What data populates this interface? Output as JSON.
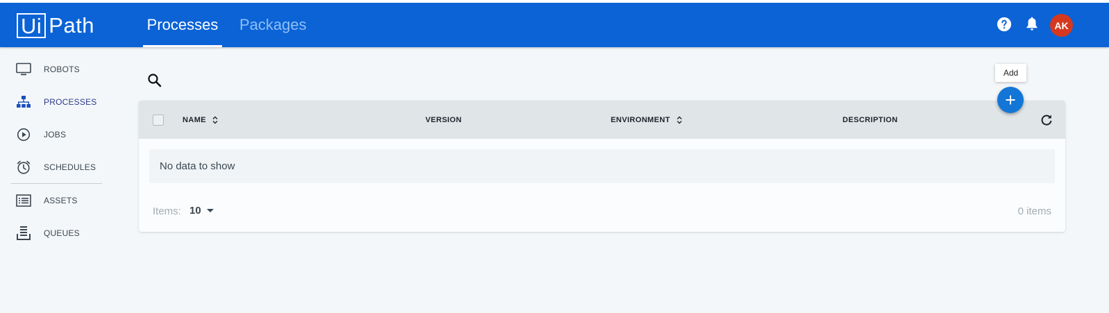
{
  "header": {
    "logo_text_boxed": "Ui",
    "logo_text_rest": "Path",
    "tabs": [
      {
        "label": "Processes",
        "active": true
      },
      {
        "label": "Packages",
        "active": false
      }
    ],
    "icons": [
      "help-icon",
      "bell-icon"
    ],
    "avatar_initials": "AK",
    "colors": {
      "bar": "#0b63d6",
      "avatar": "#d6381f"
    }
  },
  "sidebar": {
    "items": [
      {
        "label": "ROBOTS",
        "icon": "monitor-icon",
        "active": false
      },
      {
        "label": "PROCESSES",
        "icon": "hierarchy-icon",
        "active": true
      },
      {
        "label": "JOBS",
        "icon": "play-circle-icon",
        "active": false
      },
      {
        "label": "SCHEDULES",
        "icon": "alarm-clock-icon",
        "active": false
      },
      {
        "label": "ASSETS",
        "icon": "list-box-icon",
        "active": false
      },
      {
        "label": "QUEUES",
        "icon": "stack-icon",
        "active": false
      }
    ]
  },
  "main": {
    "add_tooltip": "Add",
    "table": {
      "columns": [
        {
          "label": "NAME",
          "sortable": true
        },
        {
          "label": "VERSION",
          "sortable": false
        },
        {
          "label": "ENVIRONMENT",
          "sortable": true
        },
        {
          "label": "DESCRIPTION",
          "sortable": false
        }
      ],
      "empty_message": "No data to show"
    },
    "pager": {
      "items_label": "Items:",
      "page_size": "10",
      "total": "0 items"
    },
    "colors": {
      "fab": "#1376d6"
    }
  }
}
